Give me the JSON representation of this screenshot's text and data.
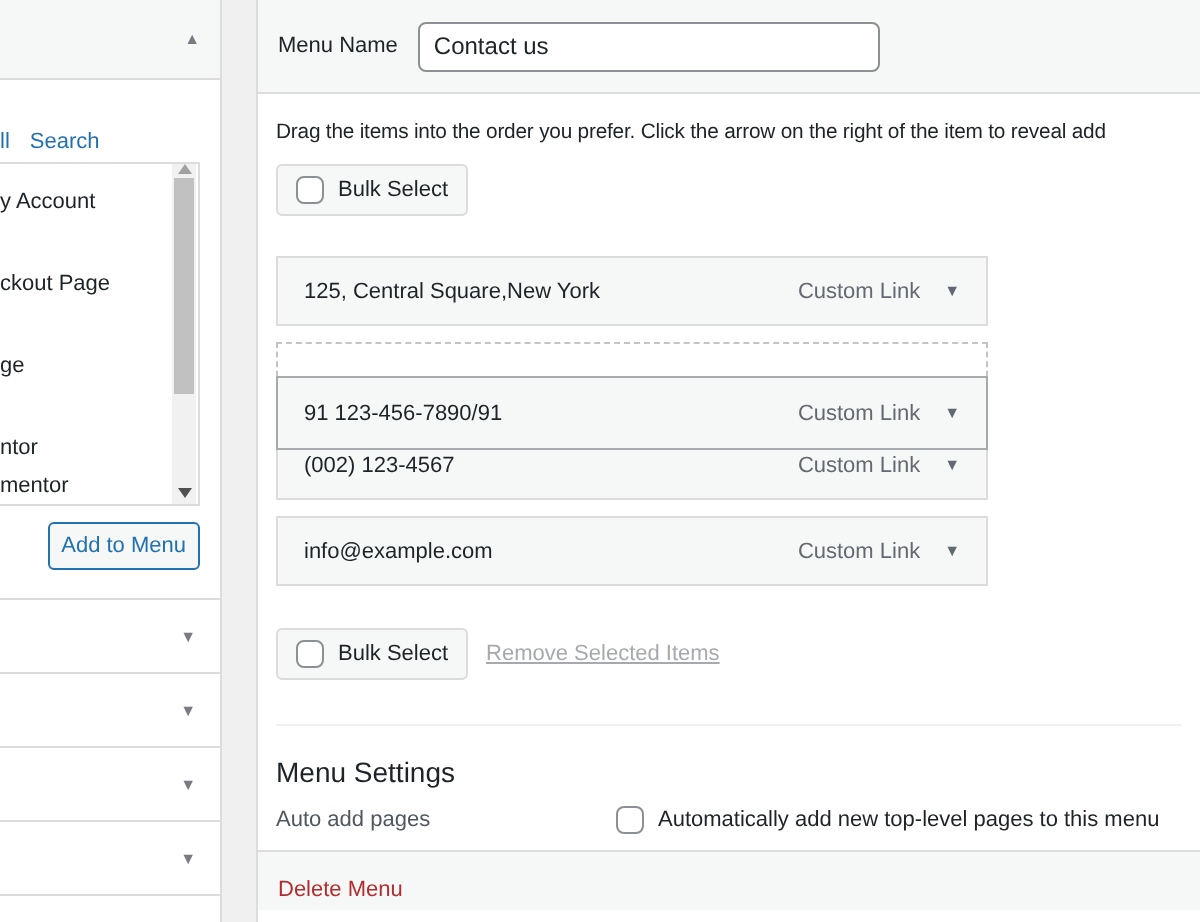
{
  "sidebar": {
    "open_section": {
      "toggle": "▲",
      "tabs": [
        {
          "label": "ll",
          "selected": false
        },
        {
          "label": "Search",
          "selected": false
        }
      ],
      "pages": [
        {
          "label": "y Account"
        },
        {
          "label": "ckout Page"
        },
        {
          "label": "ge"
        },
        {
          "label": "ntor"
        },
        {
          "label": "mentor"
        }
      ],
      "add_button": "Add to Menu"
    },
    "sections": [
      {
        "toggle": "▼"
      },
      {
        "toggle": "▼"
      },
      {
        "toggle": "▼"
      },
      {
        "toggle": "▼"
      }
    ]
  },
  "editor": {
    "menu_name_label": "Menu Name",
    "menu_name": "Contact us",
    "instructions": "Drag the items into the order you prefer. Click the arrow on the right of the item to reveal add",
    "bulk_select_top": {
      "label": "Bulk Select",
      "checked": false
    },
    "items": [
      {
        "kind": "item",
        "title": "125, Central Square,New York",
        "type": "Custom Link",
        "toggle": "▼",
        "dragging": false
      },
      {
        "kind": "placeholder"
      },
      {
        "kind": "item",
        "title": "91 123-456-7890/91",
        "type": "Custom Link",
        "toggle": "▼",
        "dragging": true
      },
      {
        "kind": "item",
        "title": "(002) 123-4567",
        "type": "Custom Link",
        "toggle": "▼",
        "dragging": false
      },
      {
        "kind": "item",
        "title": "info@example.com",
        "type": "Custom Link",
        "toggle": "▼",
        "dragging": false
      }
    ],
    "bulk_select_bottom": {
      "label": "Bulk Select",
      "checked": false
    },
    "remove_link": "Remove Selected Items",
    "settings": {
      "heading": "Menu Settings",
      "label": "Auto add pages",
      "option": {
        "label": "Automatically add new top-level pages to this menu",
        "checked": false
      }
    },
    "delete_link": "Delete Menu"
  }
}
